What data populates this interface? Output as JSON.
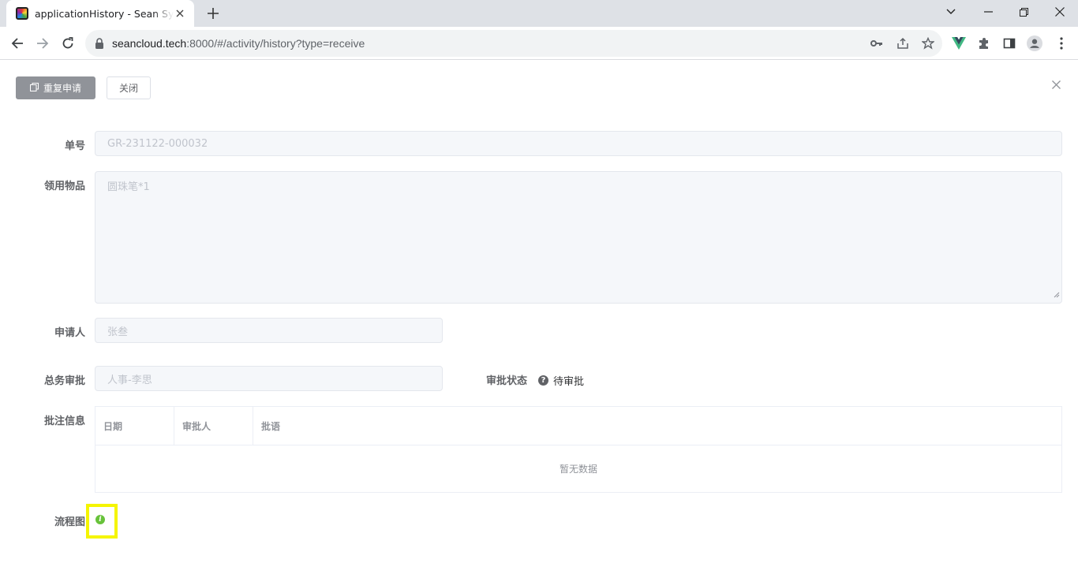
{
  "browser": {
    "tab_title": "applicationHistory - Sean Syst",
    "url_host": "seancloud.tech",
    "url_rest": ":8000/#/activity/history?type=receive"
  },
  "toolbar": {
    "repeat_label": "重复申请",
    "close_label": "关闭"
  },
  "form": {
    "order_no_label": "单号",
    "order_no_value": "GR-231122-000032",
    "items_label": "领用物品",
    "items_value": "圆珠笔*1",
    "applicant_label": "申请人",
    "applicant_value": "张叁",
    "approver_label": "总务审批",
    "approver_value": "人事-李思",
    "status_label": "审批状态",
    "status_value": "待审批",
    "remarks_label": "批注信息",
    "flowchart_label": "流程图"
  },
  "table": {
    "columns": [
      "日期",
      "审批人",
      "批语"
    ],
    "empty_text": "暂无数据"
  },
  "colors": {
    "accent_green": "#67c23a",
    "highlight": "#f5f500"
  }
}
